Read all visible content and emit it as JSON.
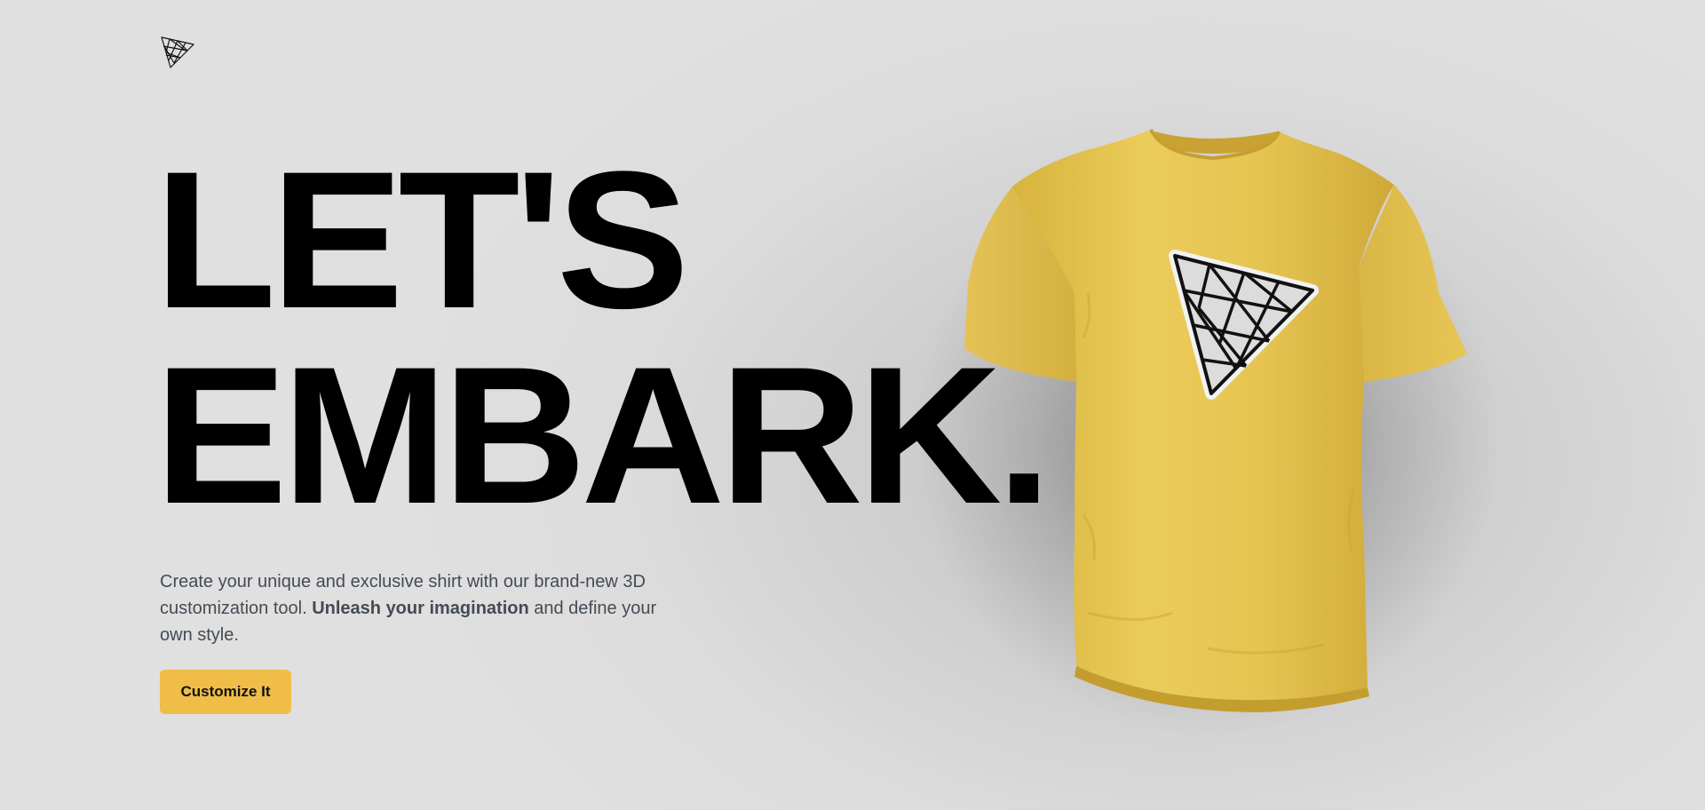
{
  "brand": {
    "logo_icon": "triangle-mesh-logo-icon"
  },
  "hero": {
    "headline_line1": "LET'S",
    "headline_line2": "EMBARK.",
    "description_part1": "Create your unique and exclusive shirt with our brand-new 3D customization tool. ",
    "description_bold": "Unleash your imagination",
    "description_part2": " and define your own style.",
    "cta_label": "Customize It"
  },
  "product": {
    "item": "t-shirt",
    "shirt_color": "#e8c652",
    "decal_icon": "triangle-mesh-decal-icon"
  },
  "colors": {
    "accent": "#efbd48",
    "background": "#e0e0e0",
    "text_muted": "#444b55"
  }
}
